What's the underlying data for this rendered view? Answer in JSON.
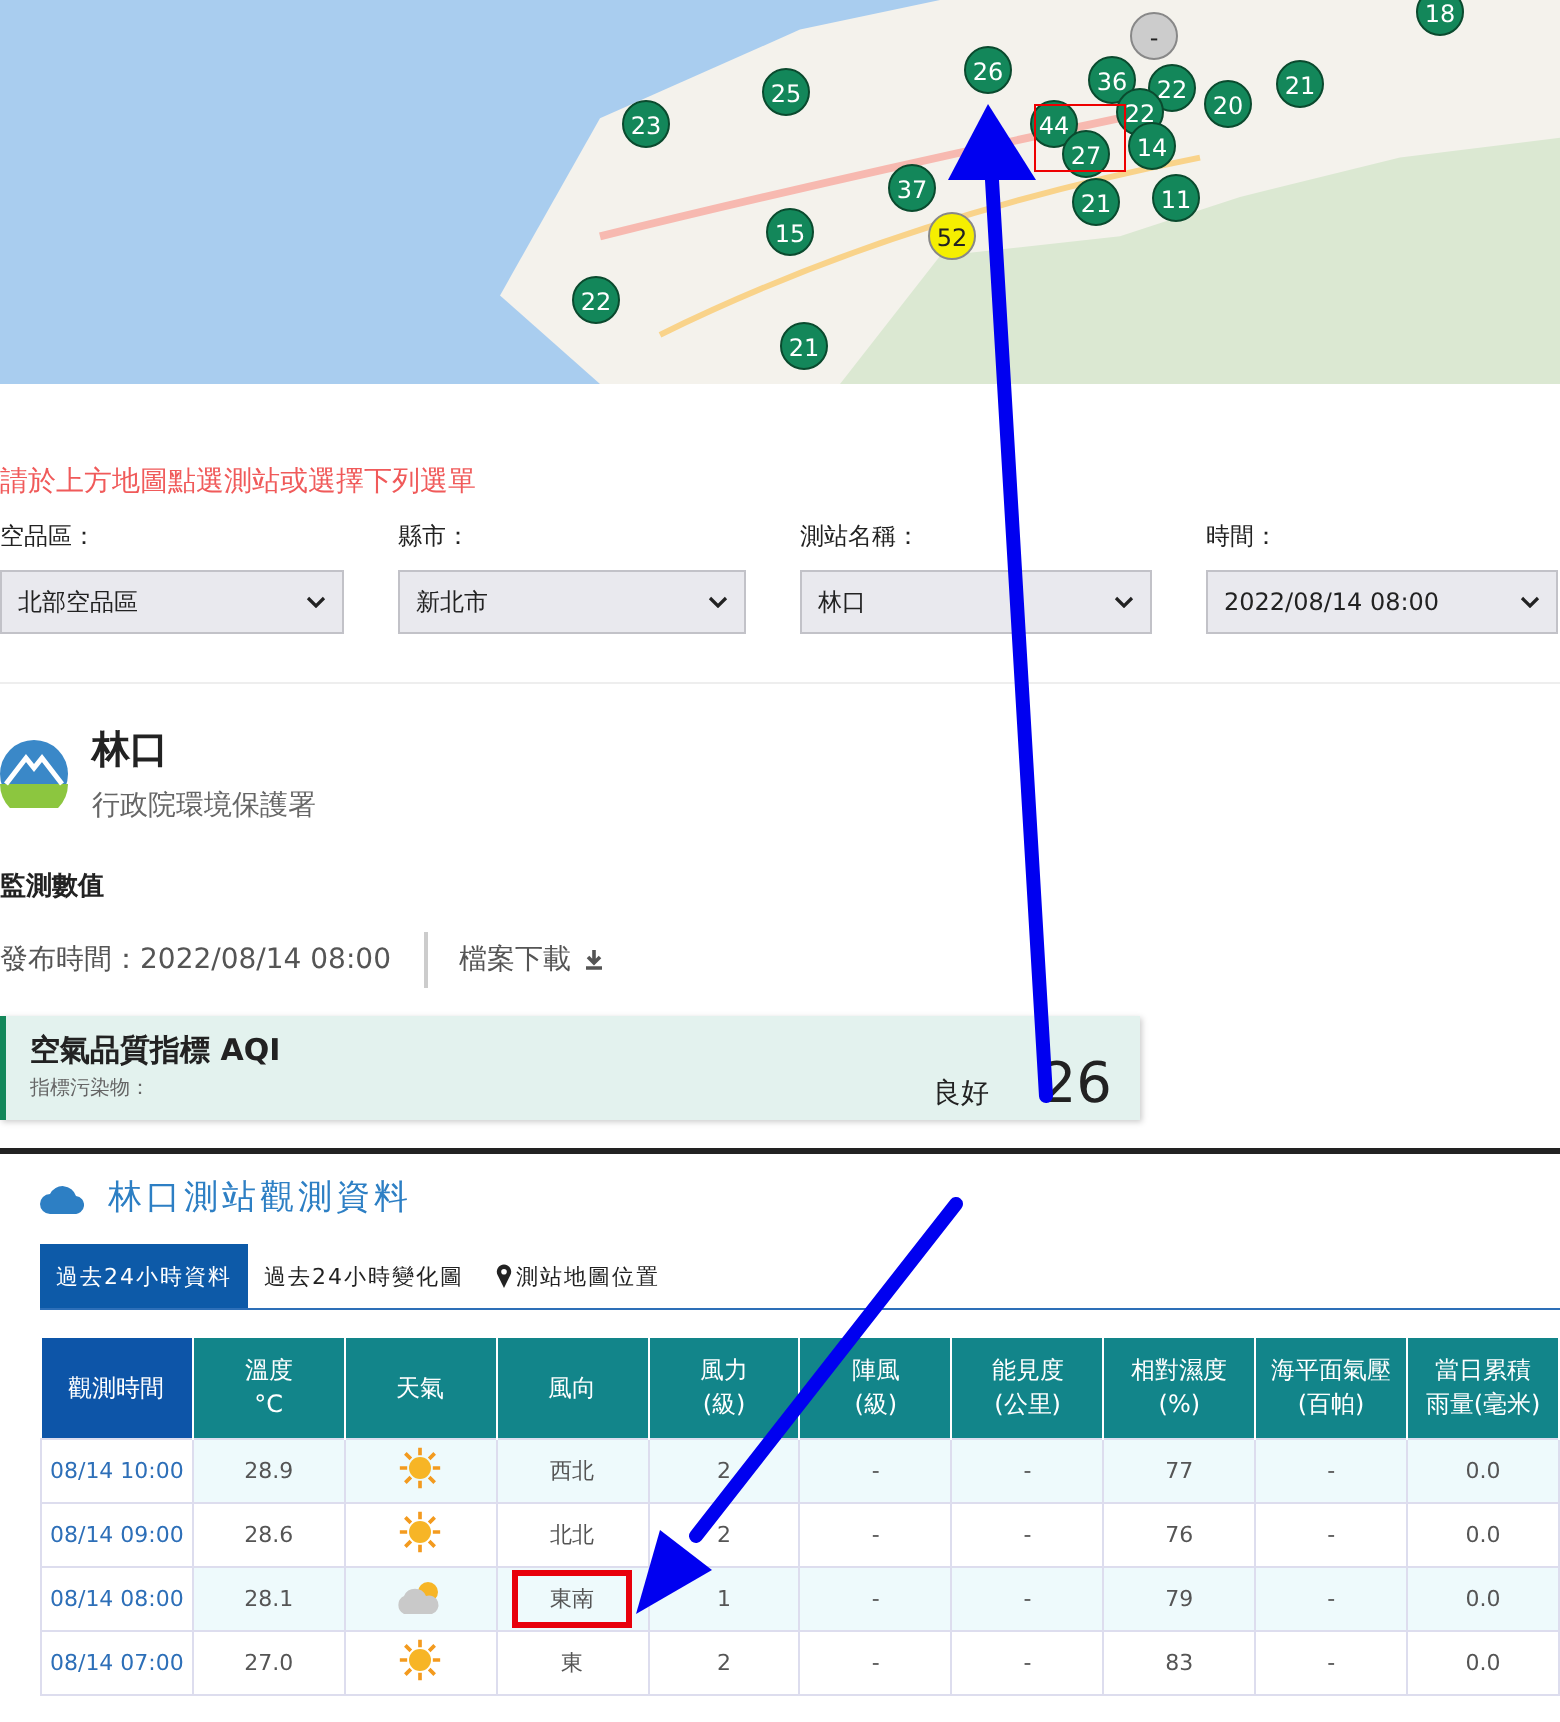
{
  "map": {
    "markers": [
      {
        "value": "18",
        "color": "#13875a"
      },
      {
        "value": "-",
        "color": "#cccccc"
      },
      {
        "value": "26",
        "color": "#13875a"
      },
      {
        "value": "25",
        "color": "#13875a"
      },
      {
        "value": "36",
        "color": "#13875a"
      },
      {
        "value": "22",
        "color": "#13875a"
      },
      {
        "value": "22",
        "color": "#13875a"
      },
      {
        "value": "20",
        "color": "#13875a"
      },
      {
        "value": "21",
        "color": "#13875a"
      },
      {
        "value": "23",
        "color": "#13875a"
      },
      {
        "value": "44",
        "color": "#13875a"
      },
      {
        "value": "27",
        "color": "#13875a"
      },
      {
        "value": "14",
        "color": "#13875a"
      },
      {
        "value": "37",
        "color": "#13875a"
      },
      {
        "value": "21",
        "color": "#13875a"
      },
      {
        "value": "11",
        "color": "#13875a"
      },
      {
        "value": "15",
        "color": "#13875a"
      },
      {
        "value": "52",
        "color": "#f5ef00"
      },
      {
        "value": "22",
        "color": "#13875a"
      },
      {
        "value": "21",
        "color": "#13875a"
      }
    ]
  },
  "form": {
    "prompt": "請於上方地圖點選測站或選擇下列選單",
    "selects": [
      {
        "label": "空品區：",
        "value": "北部空品區"
      },
      {
        "label": "縣市：",
        "value": "新北市"
      },
      {
        "label": "測站名稱：",
        "value": "林口"
      },
      {
        "label": "時間：",
        "value": "2022/08/14 08:00"
      }
    ]
  },
  "station": {
    "name": "林口",
    "agency": "行政院環境保護署",
    "section_title": "監測數值",
    "publish_time": "發布時間：2022/08/14 08:00",
    "download": "檔案下載",
    "aqi": {
      "title": "空氣品質指標 AQI",
      "pollutant_label": "指標污染物：",
      "status": "良好",
      "value": "26"
    }
  },
  "observations": {
    "title": "林口測站觀測資料",
    "tabs": [
      {
        "label": "過去24小時資料",
        "selected": true,
        "kind": "plain"
      },
      {
        "label": "過去24小時變化圖",
        "selected": false,
        "kind": "plain"
      },
      {
        "label": "測站地圖位置",
        "selected": false,
        "kind": "location"
      }
    ],
    "table": {
      "columns": [
        {
          "title": "觀測時間"
        },
        {
          "title": "溫度",
          "unit": "°C"
        },
        {
          "title": "天氣"
        },
        {
          "title": "風向"
        },
        {
          "title": "風力",
          "unit": "(級)"
        },
        {
          "title": "陣風",
          "unit": "(級)"
        },
        {
          "title": "能見度",
          "unit": "(公里)"
        },
        {
          "title": "相對濕度",
          "unit": "(%)"
        },
        {
          "title": "海平面氣壓",
          "unit": "(百帕)"
        },
        {
          "title": "當日累積",
          "unit": "雨量(毫米)"
        }
      ],
      "rows": [
        {
          "time": "08/14 10:00",
          "temp": "28.9",
          "weather": {
            "kind": "sunny"
          },
          "wind_dir": "西北",
          "wind_force": "2",
          "gust": "-",
          "visibility": "-",
          "humidity": "77",
          "pressure": "-",
          "rain": "0.0",
          "annotated": false
        },
        {
          "time": "08/14 09:00",
          "temp": "28.6",
          "weather": {
            "kind": "sunny"
          },
          "wind_dir": "北北",
          "wind_force": "2",
          "gust": "-",
          "visibility": "-",
          "humidity": "76",
          "pressure": "-",
          "rain": "0.0",
          "annotated": false
        },
        {
          "time": "08/14 08:00",
          "temp": "28.1",
          "weather": {
            "kind": "partly_cloudy"
          },
          "wind_dir": "東南",
          "wind_force": "1",
          "gust": "-",
          "visibility": "-",
          "humidity": "79",
          "pressure": "-",
          "rain": "0.0",
          "annotated": true
        },
        {
          "time": "08/14 07:00",
          "temp": "27.0",
          "weather": {
            "kind": "sunny"
          },
          "wind_dir": "東",
          "wind_force": "2",
          "gust": "-",
          "visibility": "-",
          "humidity": "83",
          "pressure": "-",
          "rain": "0.0",
          "annotated": false
        }
      ]
    }
  }
}
